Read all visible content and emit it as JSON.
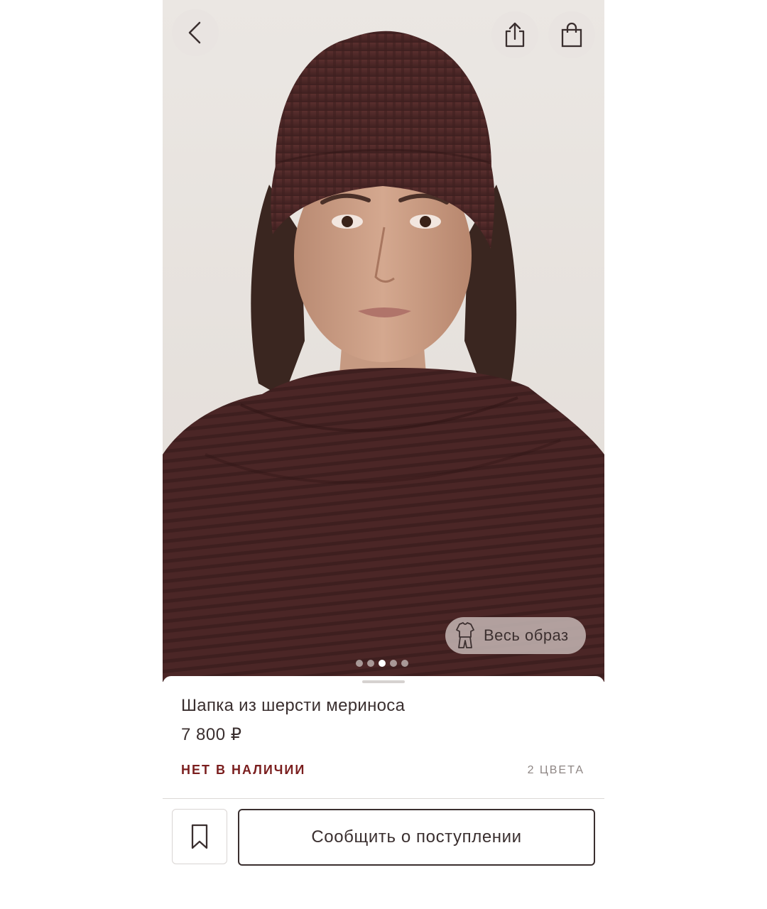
{
  "product": {
    "title": "Шапка из шерсти мериноса",
    "price": "7 800 ₽",
    "stock_status": "НЕТ В НАЛИЧИИ",
    "colors_count": "2 ЦВЕТА",
    "color_hex": "#4a2626"
  },
  "gallery": {
    "total_images": 5,
    "active_index": 3,
    "look_button_label": "Весь образ"
  },
  "header": {
    "back_icon": "chevron-left-icon",
    "share_icon": "share-icon",
    "bag_icon": "shopping-bag-icon"
  },
  "actions": {
    "bookmark_icon": "bookmark-icon",
    "notify_label": "Сообщить о поступлении"
  },
  "colors": {
    "text_primary": "#3a2f2f",
    "status_red": "#7a1e1e",
    "muted": "#8e8684"
  }
}
